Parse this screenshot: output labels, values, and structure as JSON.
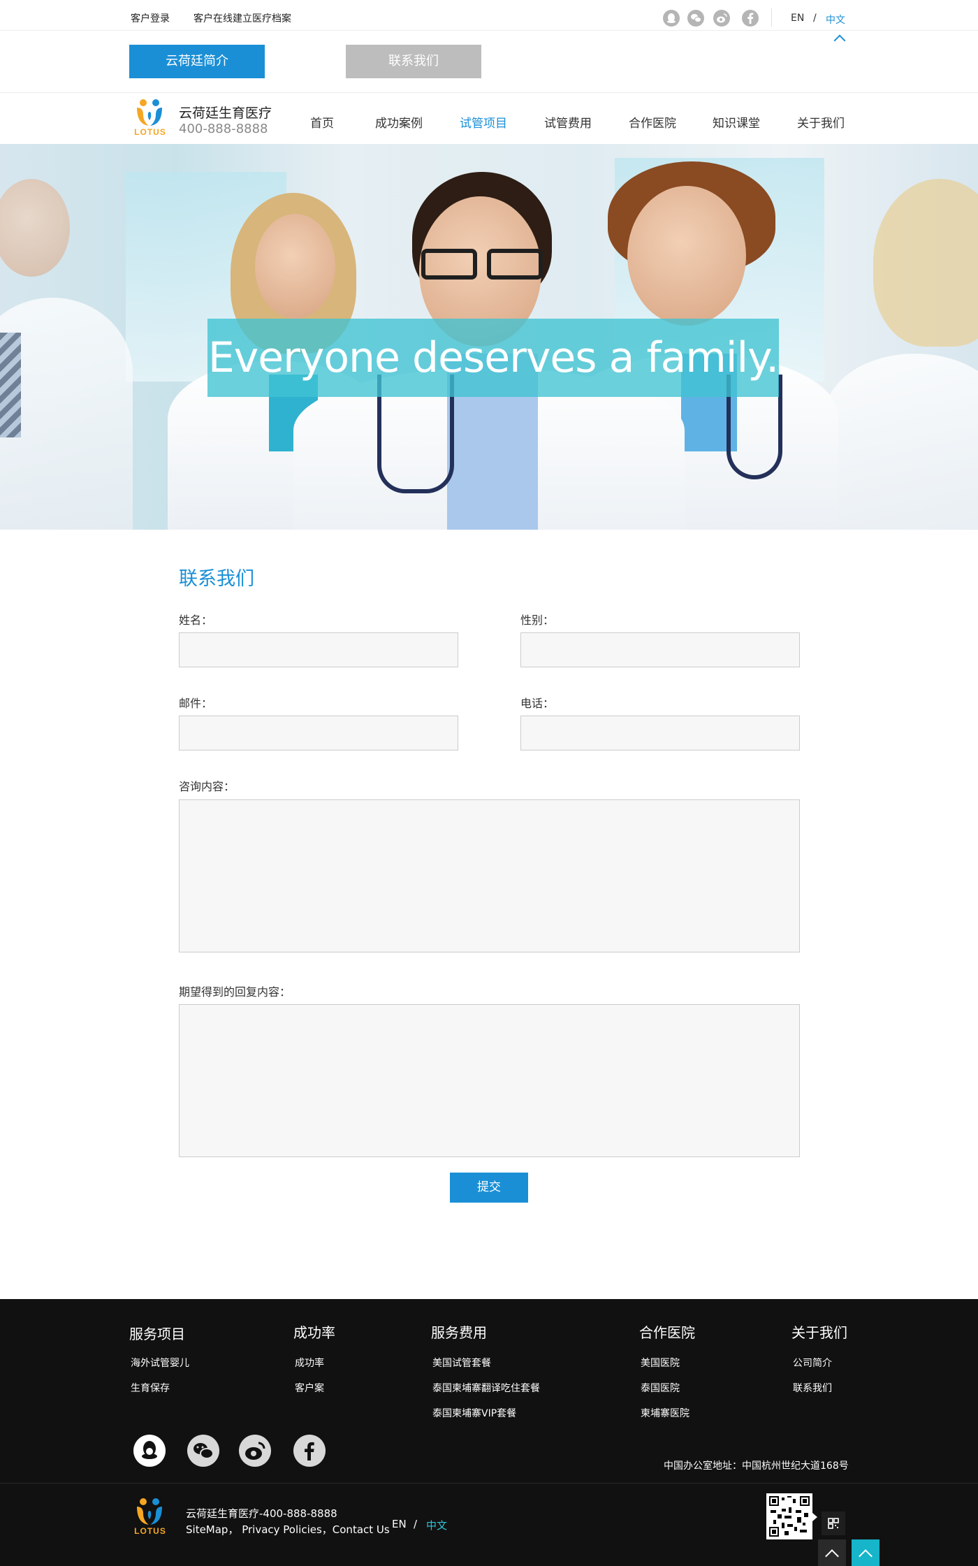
{
  "topbar": {
    "login": "客户登录",
    "archive": "客户在线建立医疗档案",
    "social_icons": [
      "qq-icon",
      "wechat-icon",
      "weibo-icon",
      "facebook-icon"
    ],
    "lang_en": "EN",
    "lang_sep": "/",
    "lang_cn": "中文"
  },
  "tabs": {
    "intro": "云荷廷简介",
    "contact": "联系我们"
  },
  "header": {
    "brand_name": "云荷廷生育医疗",
    "phone": "400-888-8888",
    "logo_text": "LOTUS"
  },
  "nav": [
    {
      "label": "首页",
      "active": false
    },
    {
      "label": "成功案例",
      "active": false
    },
    {
      "label": "试管项目",
      "active": true
    },
    {
      "label": "试管费用",
      "active": false
    },
    {
      "label": "合作医院",
      "active": false
    },
    {
      "label": "知识课堂",
      "active": false
    },
    {
      "label": "关于我们",
      "active": false
    }
  ],
  "hero": {
    "tagline": "Everyone deserves a family."
  },
  "form": {
    "title": "联系我们",
    "name_label": "姓名：",
    "gender_label": "性别：",
    "email_label": "邮件：",
    "phone_label": "电话：",
    "inquiry_label": "咨询内容：",
    "expected_label": "期望得到的回复内容：",
    "name_value": "",
    "gender_value": "",
    "email_value": "",
    "phone_value": "",
    "inquiry_value": "",
    "expected_value": "",
    "submit_label": "提交"
  },
  "footer": {
    "columns": [
      {
        "title": "服务项目",
        "items": [
          "海外试管婴儿",
          "生育保存"
        ]
      },
      {
        "title": "成功率",
        "items": [
          "成功率",
          "客户案"
        ]
      },
      {
        "title": "服务费用",
        "items": [
          "美国试管套餐",
          "泰国柬埔寨翻译吃住套餐",
          "泰国柬埔寨VIP套餐"
        ]
      },
      {
        "title": "合作医院",
        "items": [
          "美国医院",
          "泰国医院",
          "柬埔寨医院"
        ]
      },
      {
        "title": "关于我们",
        "items": [
          "公司简介",
          "联系我们"
        ]
      }
    ],
    "social_icons": [
      "qq-icon",
      "wechat-icon",
      "weibo-icon",
      "facebook-icon"
    ],
    "address": "中国办公室地址：中国杭州世纪大道168号",
    "brand_line": "云荷廷生育医疗-400-888-8888",
    "links": "SiteMap， Privacy Policies，Contact Us",
    "lang_en": "EN",
    "lang_sep": "/",
    "lang_cn": "中文",
    "logo_text": "LOTUS"
  },
  "colors": {
    "accent": "#1a8fd6",
    "banner": "#40c3d2",
    "footer_bg": "#111111",
    "back_to_top_active": "#16b5c9"
  }
}
